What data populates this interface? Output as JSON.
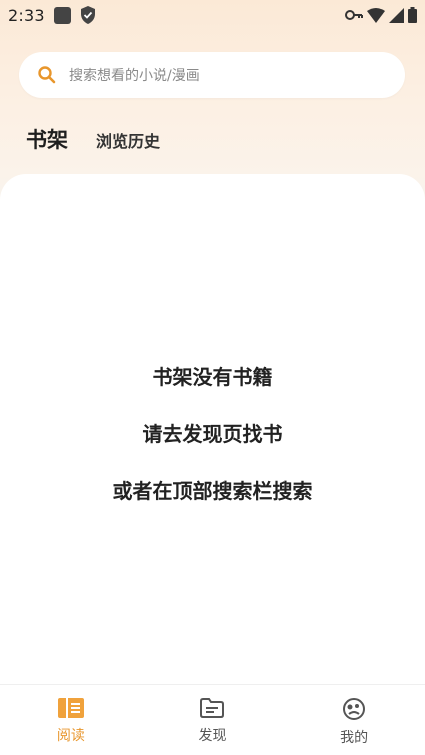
{
  "status_bar": {
    "time": "2:33"
  },
  "search": {
    "placeholder": "搜索想看的小说/漫画"
  },
  "tabs": [
    {
      "label": "书架",
      "active": true
    },
    {
      "label": "浏览历史",
      "active": false
    }
  ],
  "empty_state": {
    "line1": "书架没有书籍",
    "line2": "请去发现页找书",
    "line3": "或者在顶部搜索栏搜索"
  },
  "bottom_nav": [
    {
      "label": "阅读",
      "icon": "book-icon",
      "active": true
    },
    {
      "label": "发现",
      "icon": "folder-icon",
      "active": false
    },
    {
      "label": "我的",
      "icon": "profile-icon",
      "active": false
    }
  ],
  "colors": {
    "accent": "#e8962c",
    "background_top": "#fbe9d6",
    "panel": "#ffffff"
  }
}
